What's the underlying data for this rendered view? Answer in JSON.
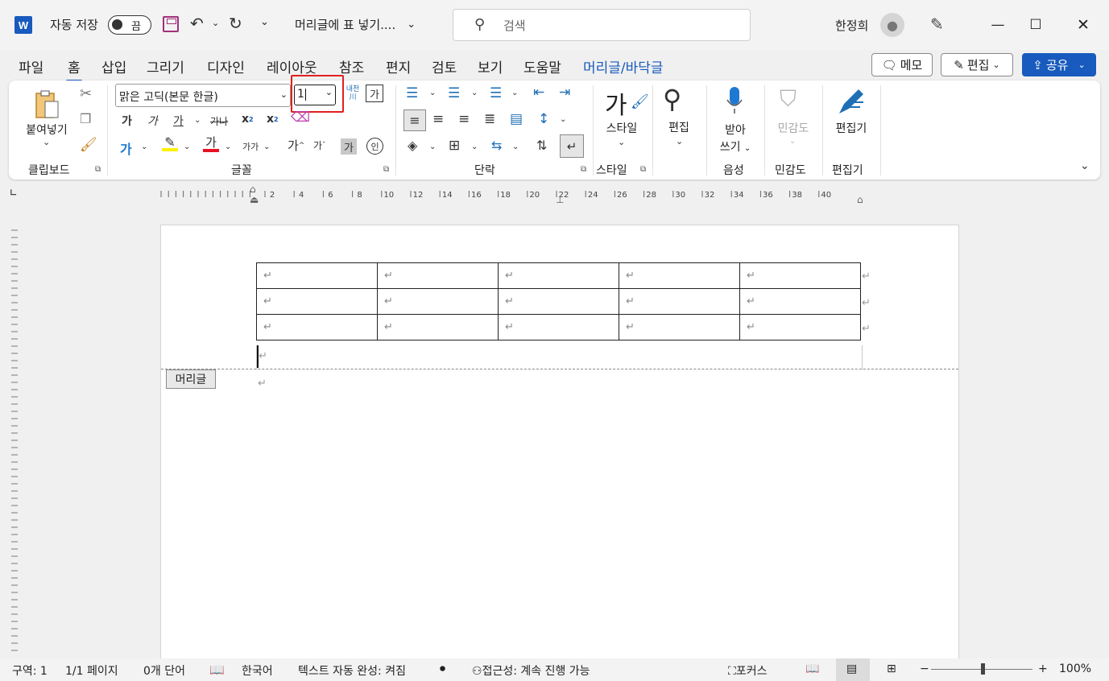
{
  "titlebar": {
    "app_logo": "W",
    "autosave_label": "자동 저장",
    "autosave_state": "끔",
    "doc_title": "머리글에 표 넣기....",
    "search_placeholder": "검색",
    "user_name": "한정희",
    "icons": [
      "save-icon",
      "undo-icon",
      "redo-icon",
      "customize-icon",
      "search-icon",
      "avatar-icon",
      "pen-icon",
      "minimize-icon",
      "maximize-icon",
      "close-icon"
    ]
  },
  "menu": {
    "tabs": [
      "파일",
      "홈",
      "삽입",
      "그리기",
      "디자인",
      "레이아웃",
      "참조",
      "편지",
      "검토",
      "보기",
      "도움말",
      "머리글/바닥글"
    ],
    "active_tab": "홈",
    "comment_label": "메모",
    "edit_label": "편집",
    "share_label": "공유"
  },
  "ribbon": {
    "clipboard": {
      "paste_label": "붙여넣기",
      "group_label": "클립보드"
    },
    "font": {
      "font_name": "맑은 고딕(본문 한글)",
      "font_size": "1",
      "phonetic_top": "내천",
      "phonetic_bottom": "川",
      "char_border": "가",
      "bold": "가",
      "italic": "가",
      "underline": "가",
      "strikethrough": "가나",
      "subscript": "x",
      "subscript_mark": "2",
      "superscript": "x",
      "superscript_mark": "2",
      "text_effects": "가",
      "font_color": "가",
      "char_size": "가가",
      "grow": "가",
      "shrink": "가",
      "char_shading": "가",
      "enclose": "인",
      "group_label": "글꼴"
    },
    "paragraph": {
      "group_label": "단락"
    },
    "styles": {
      "label": "스타일",
      "group_label": "스타일",
      "glyph": "가"
    },
    "editing": {
      "label": "편집"
    },
    "voice": {
      "label_line1": "받아",
      "label_line2": "쓰기",
      "group_label": "음성"
    },
    "sensitivity": {
      "label": "민감도",
      "group_label": "민감도"
    },
    "editor": {
      "label": "편집기",
      "group_label": "편집기"
    }
  },
  "ruler": {
    "numbers": [
      "2",
      "4",
      "6",
      "8",
      "10",
      "12",
      "14",
      "16",
      "18",
      "20",
      "22",
      "24",
      "26",
      "28",
      "30",
      "32",
      "34",
      "36",
      "38",
      "40"
    ]
  },
  "document": {
    "table": {
      "rows": 3,
      "cols": 5,
      "cell_mark": "↵"
    },
    "header_tag": "머리글"
  },
  "statusbar": {
    "section": "구역: 1",
    "page": "1/1 페이지",
    "words": "0개 단어",
    "language": "한국어",
    "autocomplete": "텍스트 자동 완성: 켜짐",
    "accessibility": "접근성: 계속 진행 가능",
    "focus": "포커스",
    "zoom": "100%"
  },
  "colors": {
    "accent": "#185abd",
    "highlight_box": "#e02020",
    "save_icon": "#a0317a",
    "font_color_bar": "#e81123",
    "highlight_bar": "#ffef00"
  }
}
